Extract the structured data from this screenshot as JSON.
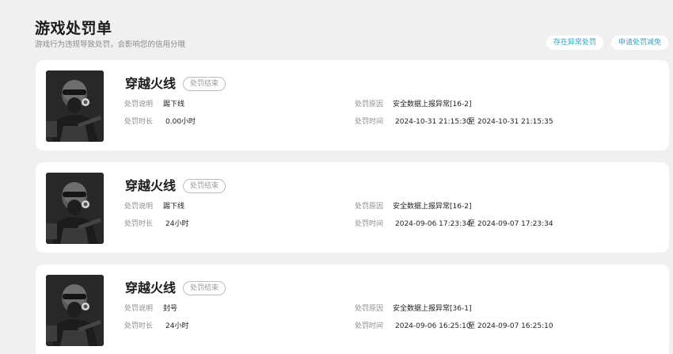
{
  "header": {
    "title": "游戏处罚单",
    "subtitle": "游戏行为违规导致处罚，会影响您的信用分哦"
  },
  "actions": {
    "report_label": "存在异常处罚",
    "appeal_label": "申请处罚减免"
  },
  "labels": {
    "desc": "处罚说明",
    "duration": "处罚时长",
    "reason": "处罚原因",
    "time": "处罚时间",
    "time_sep": "至"
  },
  "records": [
    {
      "game": "穿越火线",
      "status": "处罚结束",
      "desc": "踢下线",
      "duration": "0.00小时",
      "reason": "安全数据上报异常[16-2]",
      "start": "2024-10-31 21:15:30",
      "end": "2024-10-31 21:15:35"
    },
    {
      "game": "穿越火线",
      "status": "处罚结束",
      "desc": "踢下线",
      "duration": "24小时",
      "reason": "安全数据上报异常[16-2]",
      "start": "2024-09-06 17:23:34",
      "end": "2024-09-07 17:23:34"
    },
    {
      "game": "穿越火线",
      "status": "处罚结束",
      "desc": "封号",
      "duration": "24小时",
      "reason": "安全数据上报异常[36-1]",
      "start": "2024-09-06 16:25:10",
      "end": "2024-09-07 16:25:10"
    }
  ],
  "colors": {
    "background": "#f0f0f0",
    "card": "#ffffff",
    "accent": "#2aa7c7"
  },
  "icons": {
    "game_avatar": "soldier-gas-mask-icon"
  }
}
